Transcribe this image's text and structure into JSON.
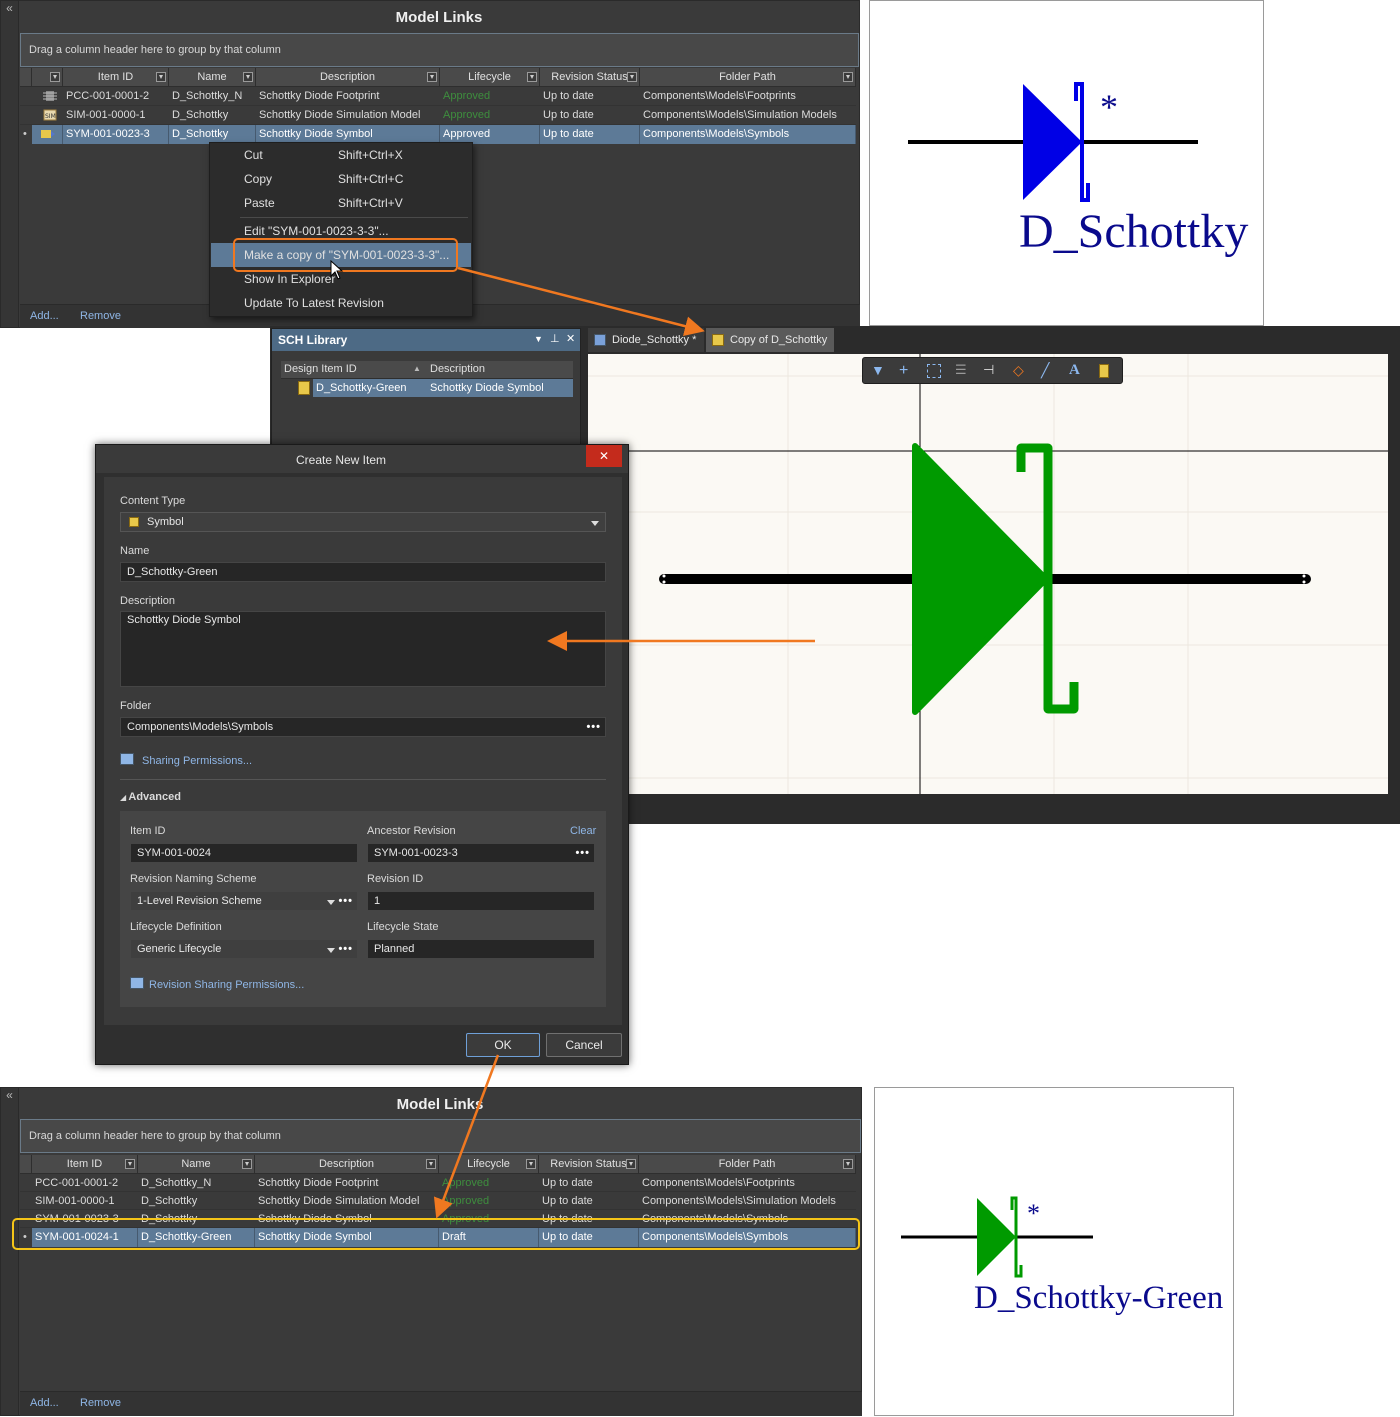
{
  "model_links_top": {
    "title": "Model Links",
    "group_hint": "Drag a column header here to group by that column",
    "columns": [
      "Item ID",
      "Name",
      "Description",
      "Lifecycle",
      "Revision Status",
      "Folder Path"
    ],
    "rows": [
      {
        "id": "PCC-001-0001-2",
        "name": "D_Schottky_N",
        "desc": "Schottky Diode Footprint",
        "lifecycle": "Approved",
        "status": "Up to date",
        "folder": "Components\\Models\\Footprints"
      },
      {
        "id": "SIM-001-0000-1",
        "name": "D_Schottky",
        "desc": "Schottky Diode Simulation Model",
        "lifecycle": "Approved",
        "status": "Up to date",
        "folder": "Components\\Models\\Simulation Models"
      },
      {
        "id": "SYM-001-0023-3",
        "name": "D_Schottky",
        "desc": "Schottky Diode Symbol",
        "lifecycle": "Approved",
        "status": "Up to date",
        "folder": "Components\\Models\\Symbols"
      }
    ],
    "add_label": "Add...",
    "remove_label": "Remove"
  },
  "context_menu": {
    "items": [
      {
        "label": "Cut",
        "shortcut": "Shift+Ctrl+X"
      },
      {
        "label": "Copy",
        "shortcut": "Shift+Ctrl+C"
      },
      {
        "label": "Paste",
        "shortcut": "Shift+Ctrl+V"
      },
      {
        "label": "Edit \"SYM-001-0023-3-3\"..."
      },
      {
        "label": "Make a copy of \"SYM-001-0023-3-3\"..."
      },
      {
        "label": "Show In Explorer"
      },
      {
        "label": "Update To Latest Revision"
      }
    ]
  },
  "preview_top": {
    "label": "D_Schottky",
    "star": "*"
  },
  "sch_library": {
    "title": "SCH Library",
    "columns": [
      "Design Item ID",
      "Description"
    ],
    "row": {
      "id": "D_Schottky-Green",
      "desc": "Schottky Diode Symbol"
    }
  },
  "editor": {
    "tabs": [
      "Diode_Schottky *",
      "Copy of D_Schottky"
    ]
  },
  "dialog": {
    "title": "Create New Item",
    "content_type_label": "Content Type",
    "content_type_value": "Symbol",
    "name_label": "Name",
    "name_value": "D_Schottky-Green",
    "description_label": "Description",
    "description_value": "Schottky Diode Symbol",
    "folder_label": "Folder",
    "folder_value": "Components\\Models\\Symbols",
    "sharing_label": "Sharing Permissions...",
    "advanced_label": "Advanced",
    "item_id_label": "Item ID",
    "item_id_value": "SYM-001-0024",
    "ancestor_label": "Ancestor Revision",
    "clear_label": "Clear",
    "ancestor_value": "SYM-001-0023-3",
    "rev_scheme_label": "Revision Naming Scheme",
    "rev_scheme_value": "1-Level Revision Scheme",
    "rev_id_label": "Revision ID",
    "rev_id_value": "1",
    "lifecycle_def_label": "Lifecycle Definition",
    "lifecycle_def_value": "Generic Lifecycle",
    "lifecycle_state_label": "Lifecycle State",
    "lifecycle_state_value": "Planned",
    "rev_sharing_label": "Revision Sharing Permissions...",
    "ok_label": "OK",
    "cancel_label": "Cancel",
    "close_glyph": "✕"
  },
  "model_links_bottom": {
    "title": "Model Links",
    "group_hint": "Drag a column header here to group by that column",
    "columns": [
      "Item ID",
      "Name",
      "Description",
      "Lifecycle",
      "Revision Status",
      "Folder Path"
    ],
    "rows": [
      {
        "id": "PCC-001-0001-2",
        "name": "D_Schottky_N",
        "desc": "Schottky Diode Footprint",
        "lifecycle": "Approved",
        "status": "Up to date",
        "folder": "Components\\Models\\Footprints"
      },
      {
        "id": "SIM-001-0000-1",
        "name": "D_Schottky",
        "desc": "Schottky Diode Simulation Model",
        "lifecycle": "Approved",
        "status": "Up to date",
        "folder": "Components\\Models\\Simulation Models"
      },
      {
        "id": "SYM-001-0023-3",
        "name": "D_Schottky",
        "desc": "Schottky Diode Symbol",
        "lifecycle": "Approved",
        "status": "Up to date",
        "folder": "Components\\Models\\Symbols"
      },
      {
        "id": "SYM-001-0024-1",
        "name": "D_Schottky-Green",
        "desc": "Schottky Diode Symbol",
        "lifecycle": "Draft",
        "status": "Up to date",
        "folder": "Components\\Models\\Symbols"
      }
    ],
    "add_label": "Add...",
    "remove_label": "Remove"
  },
  "preview_bottom": {
    "label": "D_Schottky-Green",
    "star": "*"
  },
  "colors": {
    "accent_orange": "#f07820",
    "highlight_yellow": "#f5c518",
    "symbol_blue": "#0000e6",
    "symbol_green": "#009a00",
    "selection_blue": "#5d7a97"
  }
}
